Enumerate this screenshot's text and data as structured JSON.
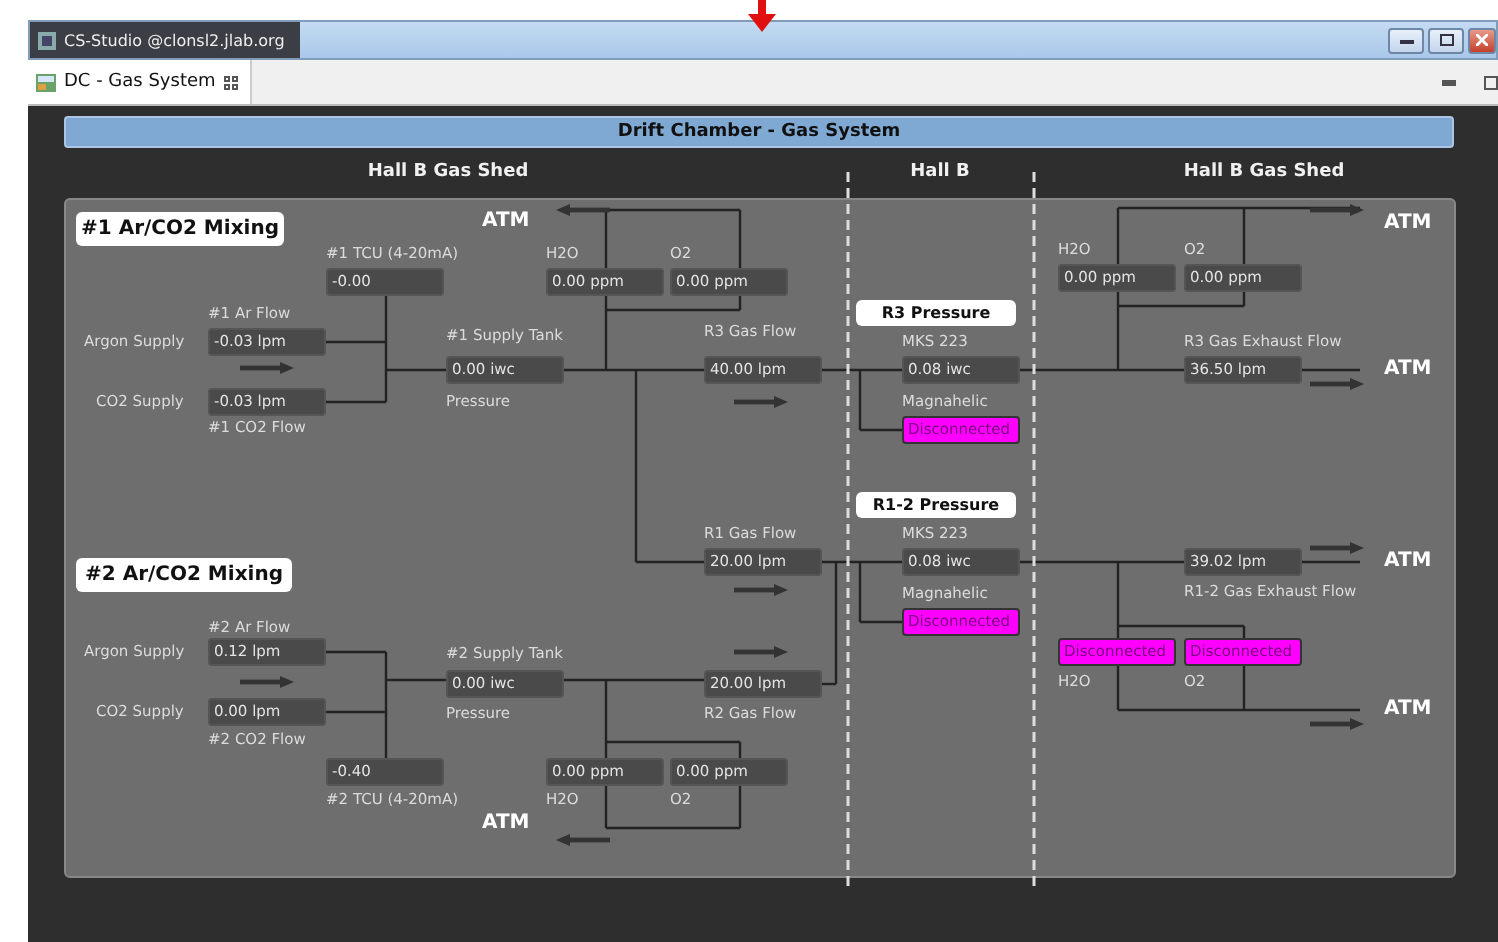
{
  "window": {
    "title": "CS-Studio @clonsl2.jlab.org"
  },
  "tab": {
    "label": "DC - Gas System",
    "selected": true
  },
  "header": "Drift Chamber - Gas System",
  "columns": [
    "Hall B Gas Shed",
    "Hall B",
    "Hall B Gas Shed"
  ],
  "mixers": [
    {
      "title": "#1 Ar/CO2 Mixing",
      "argon": {
        "label": "Argon Supply",
        "caption": "#1 Ar Flow",
        "value": "-0.03 lpm"
      },
      "co2": {
        "label": "CO2 Supply",
        "caption": "#1 CO2 Flow",
        "value": "-0.03 lpm"
      },
      "tcu": {
        "caption": "#1 TCU (4-20mA)",
        "value": "-0.00"
      },
      "tank": {
        "caption": "#1 Supply Tank",
        "value": "0.00 iwc",
        "note": "Pressure"
      },
      "h2o": {
        "caption": "H2O",
        "value": "0.00 ppm"
      },
      "o2": {
        "caption": "O2",
        "value": "0.00 ppm"
      },
      "atm": "ATM"
    },
    {
      "title": "#2 Ar/CO2 Mixing",
      "argon": {
        "label": "Argon Supply",
        "caption": "#2 Ar Flow",
        "value": "0.12 lpm"
      },
      "co2": {
        "label": "CO2 Supply",
        "caption": "#2 CO2 Flow",
        "value": "0.00 lpm"
      },
      "tcu": {
        "caption": "#2 TCU (4-20mA)",
        "value": "-0.40"
      },
      "tank": {
        "caption": "#2 Supply Tank",
        "value": "0.00 iwc",
        "note": "Pressure"
      },
      "h2o": {
        "caption": "H2O",
        "value": "0.00 ppm"
      },
      "o2": {
        "caption": "O2",
        "value": "0.00 ppm"
      },
      "atm": "ATM"
    }
  ],
  "flows": [
    {
      "caption": "R3 Gas Flow",
      "value": "40.00 lpm"
    },
    {
      "caption": "R1 Gas Flow",
      "value": "20.00 lpm"
    },
    {
      "caption": "R2 Gas Flow",
      "value": "20.00 lpm"
    }
  ],
  "pressures": [
    {
      "title": "R3 Pressure",
      "sensor": "MKS 223",
      "value": "0.08 iwc",
      "gauge": "Magnahelic",
      "gauge_value": "Disconnected",
      "gauge_disconnected": true
    },
    {
      "title": "R1-2 Pressure",
      "sensor": "MKS 223",
      "value": "0.08 iwc",
      "gauge": "Magnahelic",
      "gauge_value": "Disconnected",
      "gauge_disconnected": true
    }
  ],
  "exhausts": [
    {
      "flow_caption": "R3 Gas Exhaust Flow",
      "flow": "36.50 lpm",
      "h2o": {
        "caption": "H2O",
        "value": "0.00 ppm",
        "disconnected": false
      },
      "o2": {
        "caption": "O2",
        "value": "0.00 ppm",
        "disconnected": false
      },
      "atm": [
        "ATM",
        "ATM"
      ]
    },
    {
      "flow_caption": "R1-2 Gas Exhaust Flow",
      "flow": "39.02 lpm",
      "h2o": {
        "caption": "H2O",
        "value": "Disconnected",
        "disconnected": true
      },
      "o2": {
        "caption": "O2",
        "value": "Disconnected",
        "disconnected": true
      },
      "atm": [
        "ATM",
        "ATM"
      ]
    }
  ]
}
